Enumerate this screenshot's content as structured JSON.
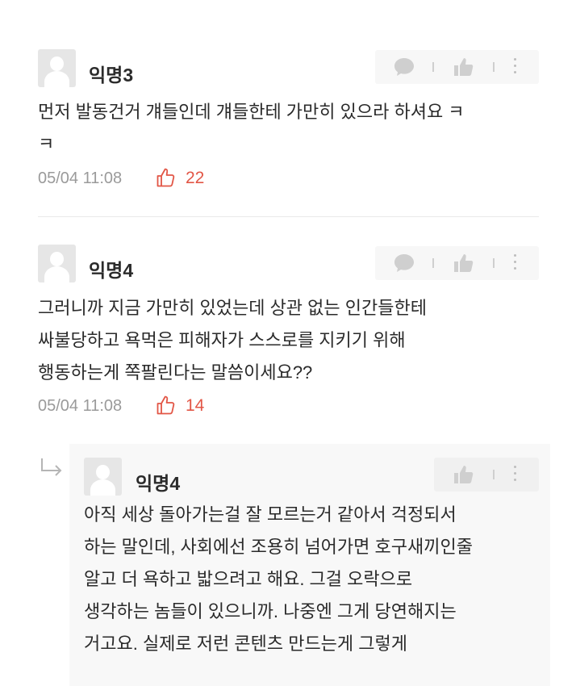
{
  "comments": [
    {
      "author": "익명3",
      "text": "먼저 발동건거 걔들인데 걔들한테 가만히 있으라 하셔요 ㅋ\nㅋ",
      "timestamp": "05/04 11:08",
      "likes": "22"
    },
    {
      "author": "익명4",
      "text": "그러니까 지금 가만히 있었는데 상관 없는 인간들한테\n싸불당하고 욕먹은 피해자가 스스로를 지키기 위해\n행동하는게 쪽팔린다는 말씀이세요??",
      "timestamp": "05/04 11:08",
      "likes": "14"
    }
  ],
  "reply": {
    "author": "익명4",
    "text": "아직 세상 돌아가는걸 잘 모르는거 같아서 걱정되서\n하는 말인데, 사회에선 조용히 넘어가면 호구새끼인줄\n알고 더 욕하고 밟으려고 해요. 그걸 오락으로\n생각하는 놈들이 있으니까. 나중엔 그게 당연해지는\n거고요. 실제로 저런 콘텐츠 만드는게 그렇게"
  },
  "icons": {
    "comment_action": "speech-bubble-icon",
    "like_action": "thumbs-up-icon",
    "more_action": "more-vertical-icon",
    "like_count_icon": "thumbs-up-outline-icon",
    "reply_indicator": "reply-arrow-icon"
  },
  "colors": {
    "like_accent": "#e25646",
    "meta_gray": "#9a9a9a",
    "action_bg": "#f7f7f7"
  }
}
